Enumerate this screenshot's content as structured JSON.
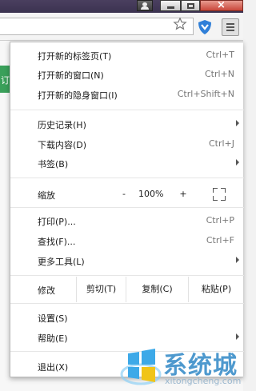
{
  "browser": {
    "icons": {
      "user": "user-icon",
      "minimize": "minimize-icon",
      "maximize": "maximize-icon",
      "close": "close-icon",
      "star": "star-icon",
      "shield": "shield-icon",
      "menu": "menu-icon"
    },
    "page_side_text": "订"
  },
  "menu": {
    "new_tab": {
      "label": "打开新的标签页(T)",
      "shortcut": "Ctrl+T"
    },
    "new_window": {
      "label": "打开新的窗口(N)",
      "shortcut": "Ctrl+N"
    },
    "incognito": {
      "label": "打开新的隐身窗口(I)",
      "shortcut": "Ctrl+Shift+N"
    },
    "history": {
      "label": "历史记录(H)"
    },
    "downloads": {
      "label": "下载内容(D)",
      "shortcut": "Ctrl+J"
    },
    "bookmarks": {
      "label": "书签(B)"
    },
    "zoom": {
      "label": "缩放",
      "minus": "-",
      "value": "100%",
      "plus": "+"
    },
    "print": {
      "label": "打印(P)...",
      "shortcut": "Ctrl+P"
    },
    "find": {
      "label": "查找(F)...",
      "shortcut": "Ctrl+F"
    },
    "more_tools": {
      "label": "更多工具(L)"
    },
    "edit": {
      "label": "修改",
      "cut": "剪切(T)",
      "copy": "复制(C)",
      "paste": "粘贴(P)"
    },
    "settings": {
      "label": "设置(S)"
    },
    "help": {
      "label": "帮助(E)"
    },
    "exit": {
      "label": "退出(X)"
    }
  },
  "watermark": {
    "text": "系统城",
    "url": "xitongcheng.com"
  },
  "colors": {
    "accent": "#3b8fc9",
    "green": "#3aa05a",
    "close": "#c9473a"
  }
}
